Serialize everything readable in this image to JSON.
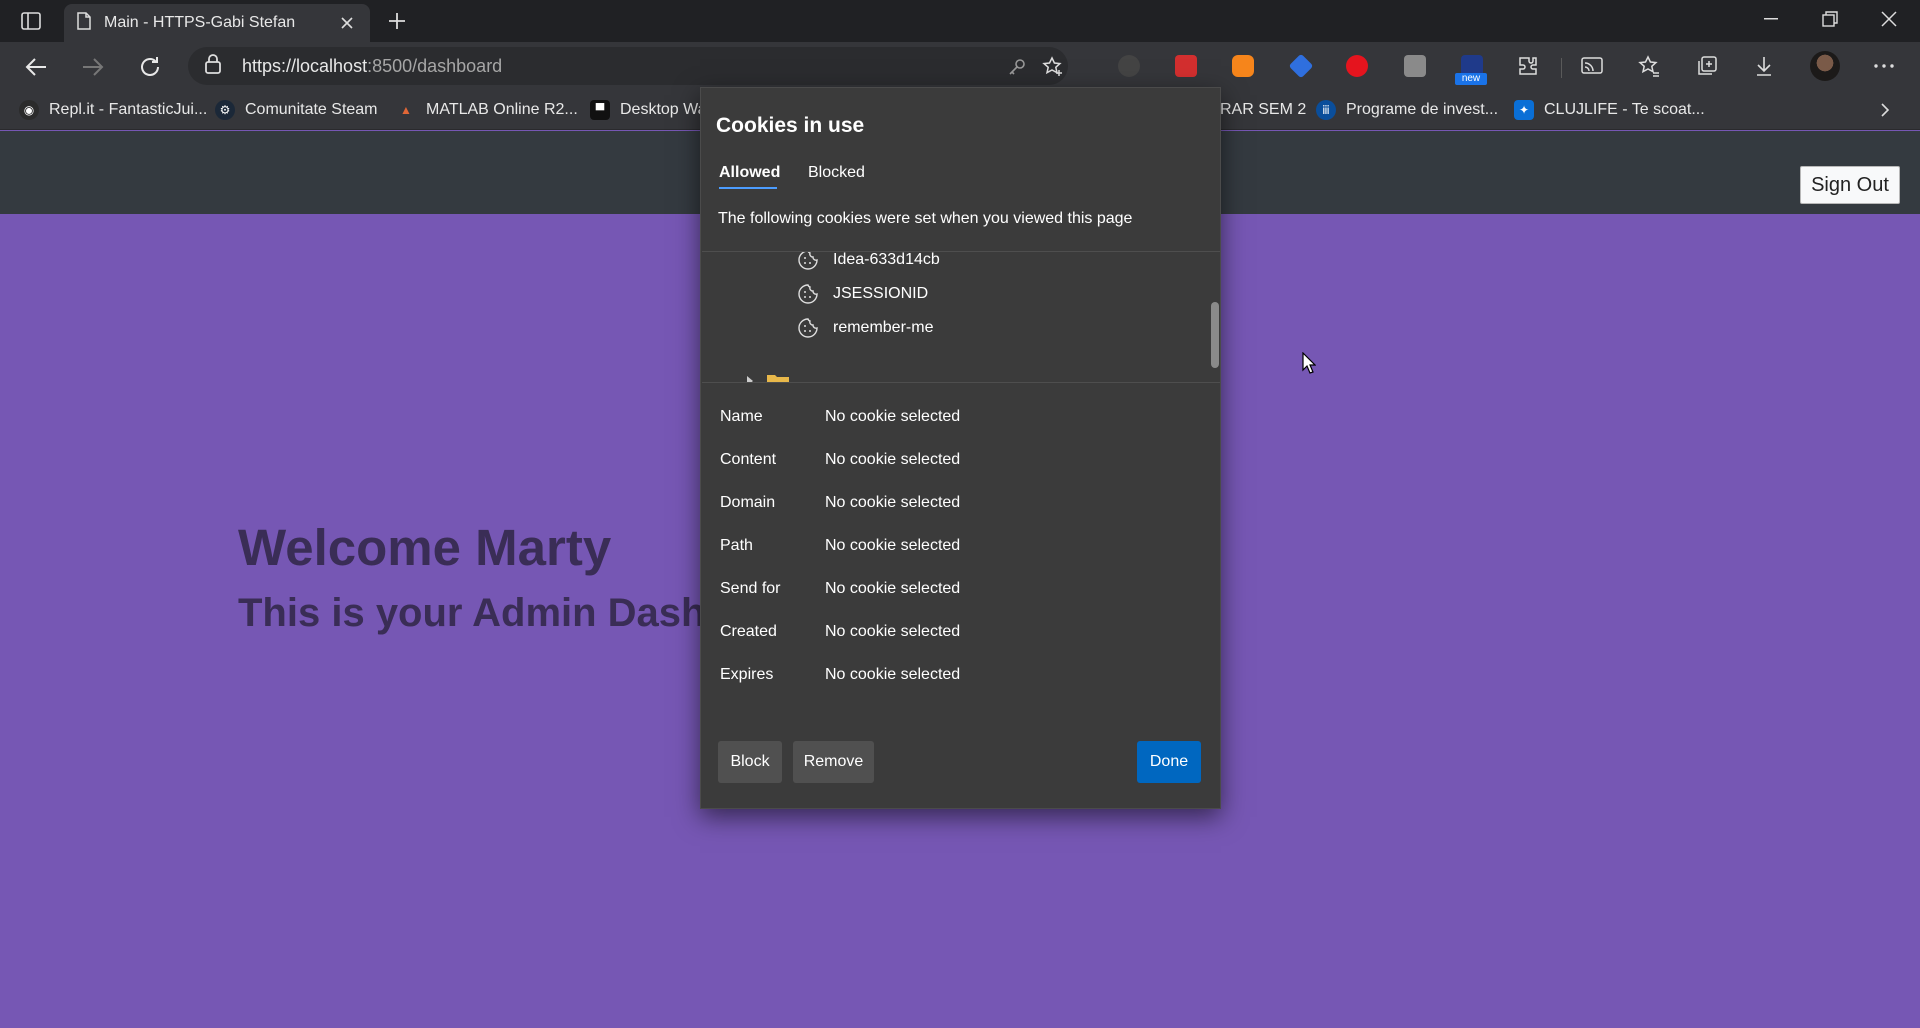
{
  "browser": {
    "tab_title": "Main - HTTPS-Gabi Stefan",
    "url_host": "https://localhost",
    "url_rest": ":8500/dashboard",
    "extension_badge": "new"
  },
  "bookmarks": [
    {
      "label": "Repl.it - FantasticJui...",
      "icon": "replit-icon",
      "color": "#2b2b2b"
    },
    {
      "label": "Comunitate Steam",
      "icon": "steam-icon",
      "color": "#1b2838"
    },
    {
      "label": "MATLAB Online R2...",
      "icon": "matlab-icon",
      "color": "#e16737"
    },
    {
      "label": "Desktop Wa",
      "icon": "desktop-icon",
      "color": "#111111"
    },
    {
      "label": "RAR SEM 2",
      "icon": "",
      "color": ""
    },
    {
      "label": "Programe de invest...",
      "icon": "invest-icon",
      "color": "#0a4e9b"
    },
    {
      "label": "CLUJLIFE - Te scoat...",
      "icon": "clujlife-icon",
      "color": "#0a6fd6"
    }
  ],
  "page": {
    "sign_out": "Sign Out",
    "welcome": "Welcome Marty",
    "subtitle": "This is your Admin Dashb"
  },
  "dialog": {
    "title": "Cookies in use",
    "tabs": [
      "Allowed",
      "Blocked"
    ],
    "description": "The following cookies were set when you viewed this page",
    "cookies": [
      "Idea-633d14cb",
      "JSESSIONID",
      "remember-me"
    ],
    "details": [
      {
        "label": "Name",
        "value": "No cookie selected"
      },
      {
        "label": "Content",
        "value": "No cookie selected"
      },
      {
        "label": "Domain",
        "value": "No cookie selected"
      },
      {
        "label": "Path",
        "value": "No cookie selected"
      },
      {
        "label": "Send for",
        "value": "No cookie selected"
      },
      {
        "label": "Created",
        "value": "No cookie selected"
      },
      {
        "label": "Expires",
        "value": "No cookie selected"
      }
    ],
    "buttons": {
      "block": "Block",
      "remove": "Remove",
      "done": "Done"
    }
  },
  "colors": {
    "page_bg": "#7657b4",
    "header_bg": "#343a40",
    "accent_blue": "#0067c0",
    "dialog_bg": "#3b3b3b"
  }
}
